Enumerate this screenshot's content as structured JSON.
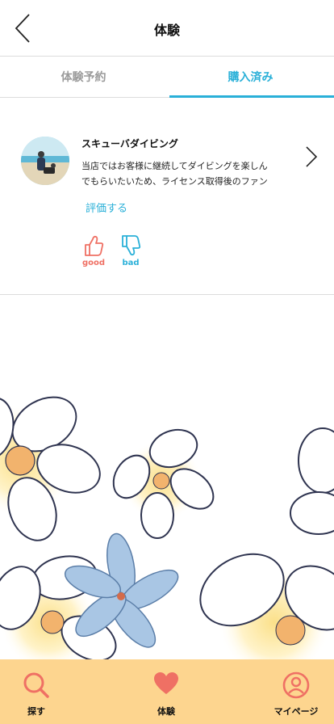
{
  "header": {
    "title": "体験",
    "back_icon": "chevron-left-icon"
  },
  "tabs": [
    {
      "label": "体験予約",
      "active": false
    },
    {
      "label": "購入済み",
      "active": true
    }
  ],
  "purchase": {
    "shop_name": "スキューバダイビング",
    "description_lines": [
      "当店ではお客様に継続してダイビングを楽しん",
      "でもらいたいため、ライセンス取得後のファン"
    ],
    "rate_link": "評価する",
    "good_label": "good",
    "bad_label": "bad"
  },
  "bottom_nav": [
    {
      "label": "探す",
      "icon": "search-icon"
    },
    {
      "label": "体験",
      "icon": "heart-icon",
      "active": true
    },
    {
      "label": "マイページ",
      "icon": "user-circle-icon"
    }
  ],
  "colors": {
    "accent": "#2ab0d8",
    "good": "#ef7064",
    "nav_background": "#fdd58f"
  }
}
